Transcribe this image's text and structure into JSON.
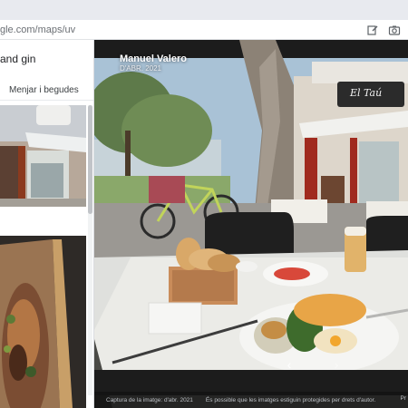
{
  "browser": {
    "url_prefix": "gle.com",
    "url_path": "/maps/uv"
  },
  "sidebar": {
    "title": "and gin",
    "tab_label": "Menjar i begudes"
  },
  "photo": {
    "author": "Manuel Valero",
    "date": "D'ABR. 2021",
    "shop_sign": "El Taú",
    "caption_date": "Captura de la imatge: d'abr. 2021",
    "caption_notice": "És possible que les imatges estiguin protegides per drets d'autor.",
    "caption_right": "Pr"
  },
  "icons": {
    "edit": "edit-icon",
    "camera": "camera-icon",
    "collapse": "chevron-left-icon",
    "prev": "chevron-left-icon",
    "next": "chevron-right-icon"
  },
  "colors": {
    "browser_chrome": "#e8eaef",
    "caption_bg": "#141414"
  }
}
